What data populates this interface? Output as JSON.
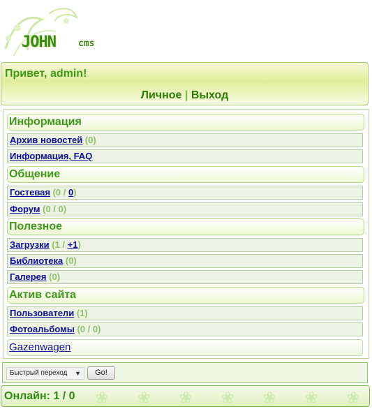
{
  "logo": {
    "main": "JOHN",
    "suffix": "cms"
  },
  "greeting": {
    "prefix": "Привет, ",
    "user": "admin",
    "suffix": "!"
  },
  "topnav": {
    "personal": "Личное",
    "separator": "|",
    "logout": "Выход"
  },
  "sections": {
    "info": "Информация",
    "communication": "Общение",
    "useful": "Полезное",
    "activity": "Актив сайта"
  },
  "items": {
    "news": {
      "label": "Архив новостей",
      "count": "(0)"
    },
    "faq": {
      "label": "Информация, FAQ"
    },
    "guestbook": {
      "label": "Гостевая",
      "open": "(0 / ",
      "red": "0",
      "close": ")"
    },
    "forum": {
      "label": "Форум",
      "count": "(0 / 0)"
    },
    "downloads": {
      "label": "Загрузки",
      "open": "(1 / ",
      "red": "+1",
      "close": ")"
    },
    "library": {
      "label": "Библиотека",
      "count": "(0)"
    },
    "gallery": {
      "label": "Галерея",
      "count": "(0)"
    },
    "users": {
      "label": "Пользователи",
      "count": "(1)"
    },
    "albums": {
      "label": "Фотоальбомы",
      "count": "(0 / 0)"
    },
    "gazenwagen": {
      "label": "Gazenwagen"
    }
  },
  "jump": {
    "select_value": "Быстрый переход",
    "go_label": "Go!"
  },
  "online": {
    "text": "Онлайн: 1 / 0"
  },
  "colors": {
    "accent_green": "#3f9a17",
    "link_blue": "#0f0f9e",
    "alert_red": "#d42020"
  }
}
